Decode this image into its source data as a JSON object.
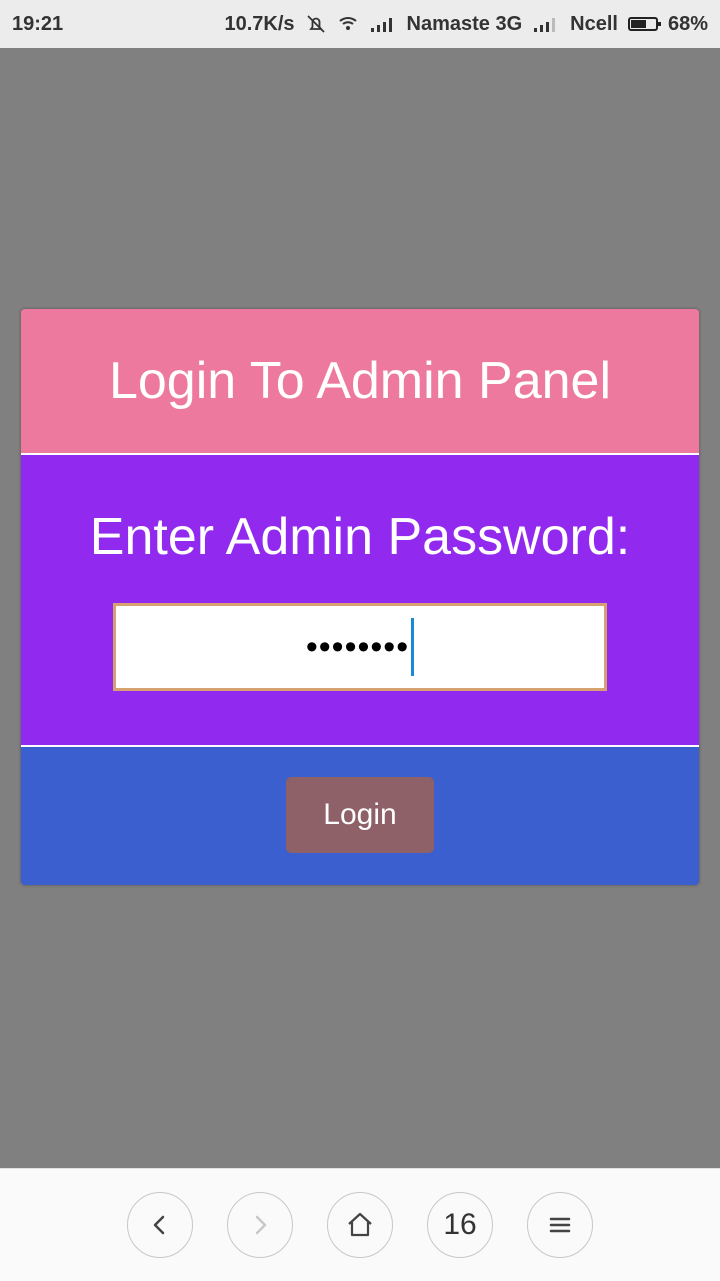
{
  "status_bar": {
    "time": "19:21",
    "speed": "10.7K/s",
    "carrier1": "Namaste 3G",
    "carrier2": "Ncell",
    "battery_percent": "68%",
    "battery_level": 0.68,
    "icons": [
      "mute-bell-icon",
      "wifi-icon",
      "signal-icon",
      "signal-icon",
      "battery-icon"
    ]
  },
  "panel": {
    "title": "Login To Admin Panel",
    "password_label": "Enter Admin Password:",
    "password_value": "••••••••",
    "login_label": "Login",
    "colors": {
      "header": "#ed7a9e",
      "body": "#9129ef",
      "footer": "#3b5fce",
      "button": "#8e6068"
    }
  },
  "browser_nav": {
    "tab_count": "16",
    "icons": [
      "back-icon",
      "forward-icon",
      "home-icon",
      "tabs-icon",
      "menu-icon"
    ]
  }
}
